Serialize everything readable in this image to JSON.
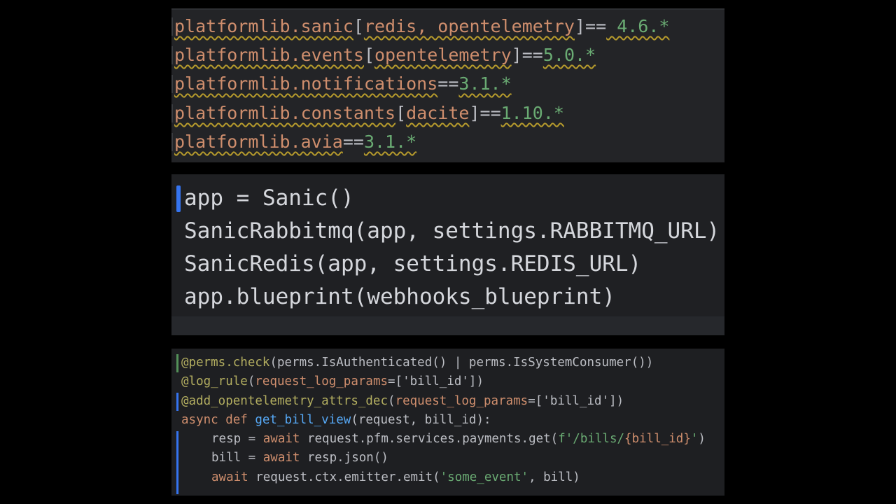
{
  "requirements": {
    "lines": [
      {
        "pkg": "platformlib.sanic",
        "extras": "redis, opentelemetry",
        "op": "==",
        "ver": " 4.6.*"
      },
      {
        "pkg": "platformlib.events",
        "extras": "opentelemetry",
        "op": "==",
        "ver": "5.0.*"
      },
      {
        "pkg": "platformlib.notifications",
        "extras": "",
        "op": "==",
        "ver": "3.1.*"
      },
      {
        "pkg": "platformlib.constants",
        "extras": "dacite",
        "op": "==",
        "ver": "1.10.*"
      },
      {
        "pkg": "platformlib.avia",
        "extras": "",
        "op": "==",
        "ver": "3.1.*"
      }
    ]
  },
  "app_setup": {
    "lines": [
      "app = Sanic()",
      "SanicRabbitmq(app, settings.RABBITMQ_URL)",
      "SanicRedis(app, settings.REDIS_URL)",
      "app.blueprint(webhooks_blueprint)"
    ]
  },
  "view_code": {
    "decorator1": "@perms.check",
    "decorator1_args": "(perms.IsAuthenticated() | perms.IsSystemConsumer())",
    "decorator2": "@log_rule",
    "decorator2_param": "request_log_params",
    "decorator2_value": "=['bill_id']",
    "decorator3": "@add_opentelemetry_attrs_dec",
    "decorator3_param": "request_log_params",
    "decorator3_value": "=['bill_id']",
    "def_keywords": "async def ",
    "def_name": "get_bill_view",
    "def_args": "(request, bill_id):",
    "line5_a": "resp = ",
    "line5_await": "await",
    "line5_b": " request.pfm.services.payments.get(",
    "line5_str": "f'/bills/",
    "line5_interp": "{bill_id}",
    "line5_str_end": "'",
    "line5_close": ")",
    "line6_a": "bill = ",
    "line6_await": "await",
    "line6_b": " resp.json()",
    "line7_await": "await",
    "line7_b": " request.ctx.emitter.emit(",
    "line7_str": "'some_event'",
    "line7_c": ", bill)"
  },
  "colors": {
    "background": "#000000",
    "editor_bg": "#1e1f22",
    "keyword": "#cf8e6d",
    "string": "#6aab73",
    "function": "#56a8f5",
    "decorator": "#b3ae60",
    "warning_underline": "#b59a2c",
    "gutter_modified": "#3574f0",
    "gutter_added": "#549159"
  }
}
